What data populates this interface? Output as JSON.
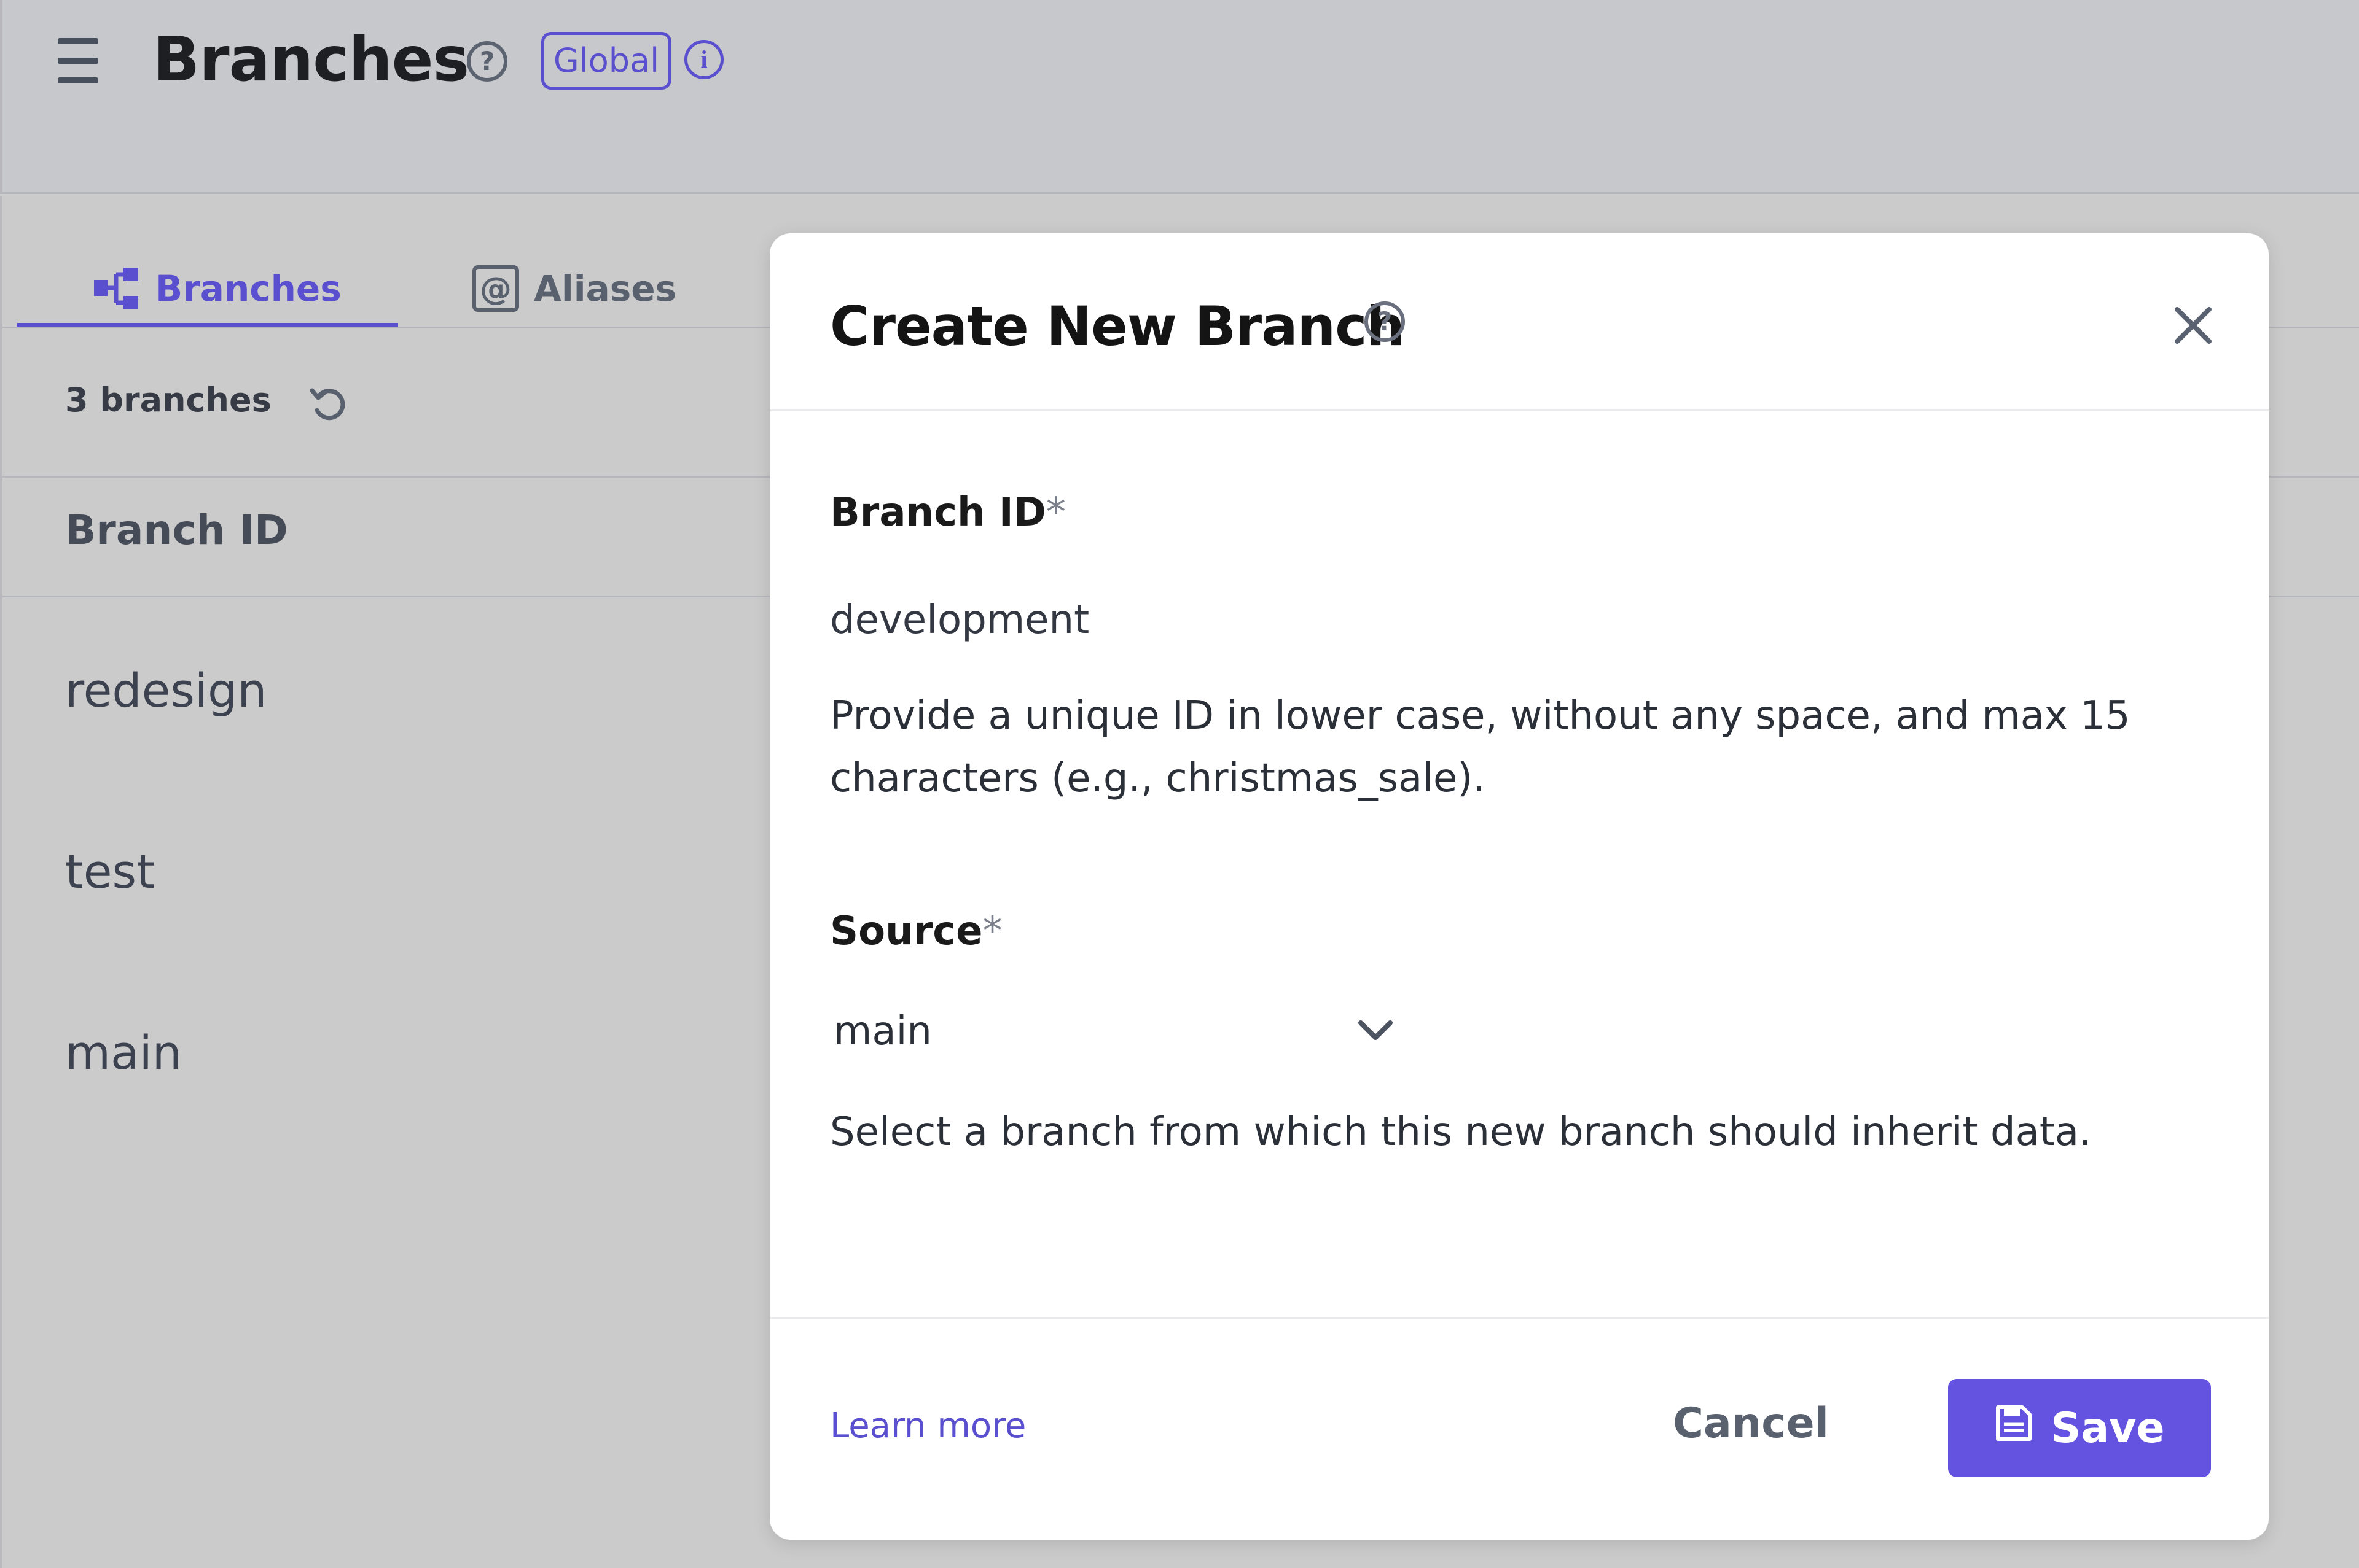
{
  "header": {
    "title": "Branches",
    "scope_badge": "Global",
    "help_icon": "question-circle-icon",
    "info_icon": "info-circle-icon",
    "menu_icon": "hamburger-icon"
  },
  "tabs": [
    {
      "label": "Branches",
      "icon": "branch-tree-icon",
      "active": true
    },
    {
      "label": "Aliases",
      "icon": "at-sign-icon",
      "active": false
    }
  ],
  "list": {
    "count_label": "3 branches",
    "refresh_icon": "refresh-icon",
    "column_header": "Branch ID",
    "rows": [
      "redesign",
      "test",
      "main"
    ]
  },
  "modal": {
    "title": "Create New Branch",
    "branch_id": {
      "label": "Branch ID",
      "required_mark": "*",
      "value": "development",
      "help": "Provide a unique ID in lower case, without any space, and max 15 characters (e.g., christmas_sale)."
    },
    "source": {
      "label": "Source",
      "required_mark": "*",
      "selected": "main",
      "help": "Select a branch from which this new branch should inherit data.",
      "learn_more": "Learn more"
    },
    "cancel_label": "Cancel",
    "save_label": "Save"
  },
  "colors": {
    "accent": "#5a4fcf",
    "save_button": "#6353e0",
    "overlay_bg": "#cbcbcb",
    "modal_bg": "#ffffff"
  }
}
